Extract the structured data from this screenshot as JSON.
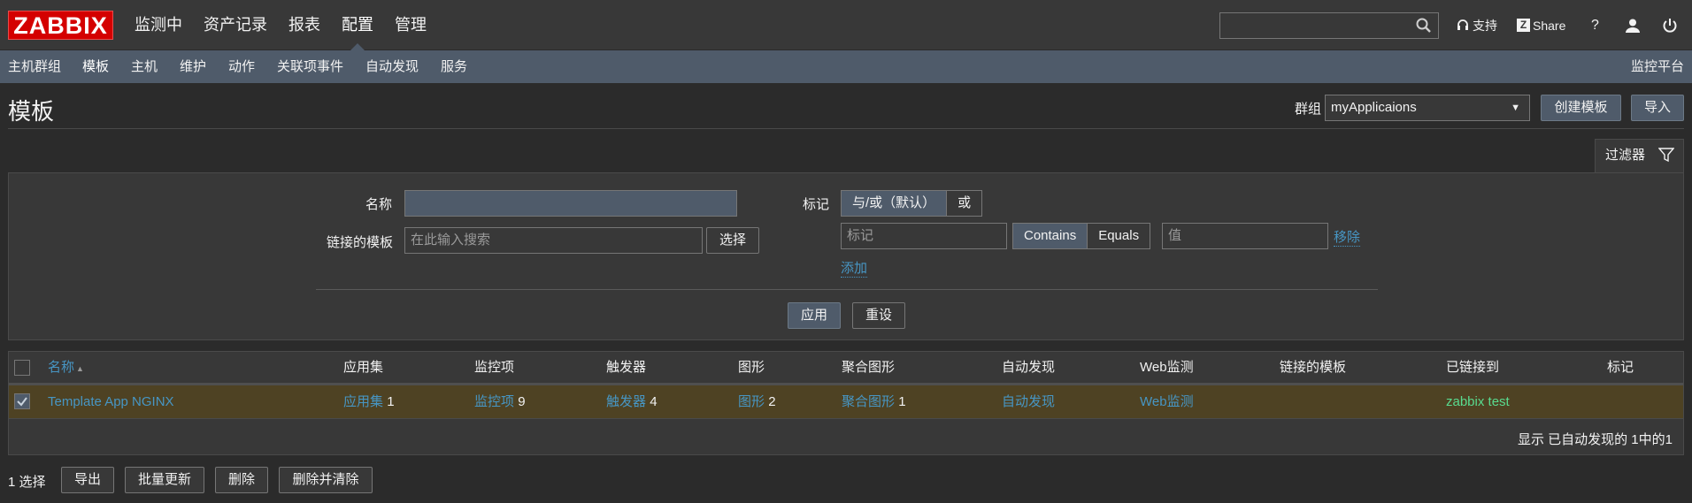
{
  "header": {
    "logo": "ZABBIX",
    "menu": [
      "监测中",
      "资产记录",
      "报表",
      "配置",
      "管理"
    ],
    "active_menu": "配置",
    "search_value": "",
    "support_label": "支持",
    "share_label": "Share",
    "help_label": "?"
  },
  "submenu": {
    "items": [
      "主机群组",
      "模板",
      "主机",
      "维护",
      "动作",
      "关联项事件",
      "自动发现",
      "服务"
    ],
    "active": "模板",
    "platform": "监控平台"
  },
  "page": {
    "title": "模板",
    "group_label": "群组",
    "group_value": "myApplicaions",
    "create_button": "创建模板",
    "import_button": "导入"
  },
  "filter": {
    "tab_label": "过滤器",
    "name_label": "名称",
    "name_value": "",
    "linked_label": "链接的模板",
    "linked_placeholder": "在此输入搜索",
    "select_button": "选择",
    "tags_label": "标记",
    "tag_mode_and": "与/或（默认）",
    "tag_mode_or": "或",
    "tag_placeholder": "标记",
    "op_contains": "Contains",
    "op_equals": "Equals",
    "value_placeholder": "值",
    "remove_link": "移除",
    "add_link": "添加",
    "apply_button": "应用",
    "reset_button": "重设"
  },
  "table": {
    "columns": [
      "名称",
      "应用集",
      "监控项",
      "触发器",
      "图形",
      "聚合图形",
      "自动发现",
      "Web监测",
      "链接的模板",
      "已链接到",
      "标记"
    ],
    "sort_indicator": "▲",
    "rows": [
      {
        "name": "Template App NGINX",
        "applications_label": "应用集",
        "applications_count": "1",
        "items_label": "监控项",
        "items_count": "9",
        "triggers_label": "触发器",
        "triggers_count": "4",
        "graphs_label": "图形",
        "graphs_count": "2",
        "screens_label": "聚合图形",
        "screens_count": "1",
        "discovery_label": "自动发现",
        "web_label": "Web监测",
        "linked_templates": "",
        "linked_to": "zabbix test",
        "tags": ""
      }
    ],
    "footer": "显示 已自动发现的 1中的1"
  },
  "actions": {
    "selected": "1 选择",
    "export": "导出",
    "mass_update": "批量更新",
    "delete": "删除",
    "delete_clear": "删除并清除"
  },
  "colors": {
    "accent": "#d40000",
    "link": "#4796c4",
    "green": "#59db8f",
    "selected_row": "#4e4223"
  }
}
